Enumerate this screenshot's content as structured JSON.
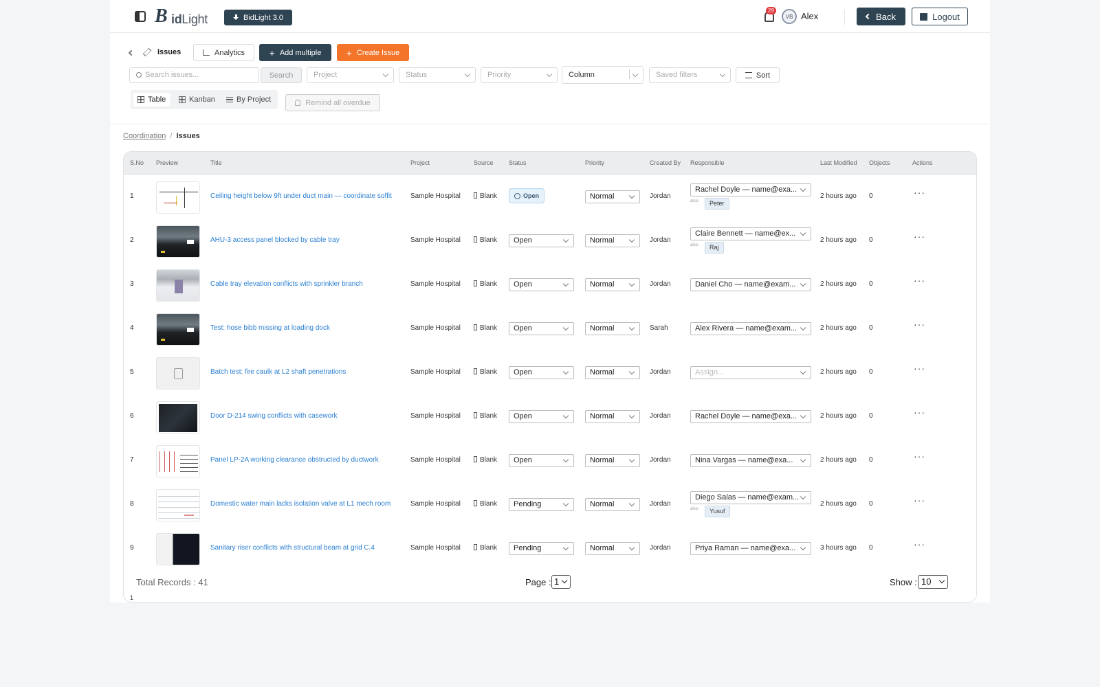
{
  "app": {
    "logo_b": "B",
    "logo_text_bold": "id",
    "logo_text_rest": "Light",
    "version_label": "BidLight 3.0",
    "notif_count": "29",
    "avatar_initials": "VB",
    "user_name": "Alex",
    "back_label": "Back",
    "logout_label": "Logout"
  },
  "toolbar": {
    "section_label": "Issues",
    "analytics_label": "Analytics",
    "add_multiple_label": "Add multiple",
    "create_issue_label": "Create Issue",
    "search_placeholder": "Search issues...",
    "search_button": "Search",
    "filters": {
      "project": "Project",
      "status": "Status",
      "priority": "Priority",
      "column": "Column",
      "saved": "Saved filters"
    },
    "sort_label": "Sort",
    "views": [
      "Table",
      "Kanban",
      "By Project"
    ],
    "active_view": "Table",
    "remind_label": "Remind all overdue"
  },
  "breadcrumb": {
    "parent": "Coordination",
    "separator": "/",
    "current": "Issues"
  },
  "table": {
    "columns": [
      "S.No",
      "Preview",
      "Title",
      "Project",
      "Source",
      "Status",
      "Priority",
      "Created By",
      "Responsible",
      "Last Modified",
      "Objects",
      "Actions"
    ],
    "also_label": "also:",
    "actions_glyph": "···",
    "rows": [
      {
        "sno": "1",
        "preview": "plan-drawing",
        "title": "Ceiling height below 9ft under duct main — coordinate soffit",
        "project": "Sample Hospital",
        "source": "Blank",
        "status": "Open",
        "status_badge": true,
        "priority": "Normal",
        "created_by": "Jordan",
        "responsible": "Rachel Doyle — name@exa...",
        "also": "Peter",
        "last_modified": "2 hours ago",
        "objects": "0"
      },
      {
        "sno": "2",
        "preview": "dark-model",
        "title": "AHU-3 access panel blocked by cable tray",
        "project": "Sample Hospital",
        "source": "Blank",
        "status": "Open",
        "priority": "Normal",
        "created_by": "Jordan",
        "responsible": "Claire Bennett — name@ex...",
        "also": "Raj",
        "last_modified": "2 hours ago",
        "objects": "0"
      },
      {
        "sno": "3",
        "preview": "tray-model",
        "title": "Cable tray elevation conflicts with sprinkler branch",
        "project": "Sample Hospital",
        "source": "Blank",
        "status": "Open",
        "priority": "Normal",
        "created_by": "Jordan",
        "responsible": "Daniel Cho — name@exam...",
        "last_modified": "2 hours ago",
        "objects": "0"
      },
      {
        "sno": "4",
        "preview": "dark-model",
        "title": "Test: hose bibb missing at loading dock",
        "project": "Sample Hospital",
        "source": "Blank",
        "status": "Open",
        "priority": "Normal",
        "created_by": "Sarah",
        "responsible": "Alex Rivera — name@exam...",
        "last_modified": "2 hours ago",
        "objects": "0"
      },
      {
        "sno": "5",
        "preview": "document-placeholder",
        "title": "Batch test: fire caulk at L2 shaft penetrations",
        "project": "Sample Hospital",
        "source": "Blank",
        "status": "Open",
        "priority": "Normal",
        "created_by": "Jordan",
        "responsible": "",
        "responsible_placeholder": "Assign...",
        "last_modified": "2 hours ago",
        "objects": "0"
      },
      {
        "sno": "6",
        "preview": "night-model",
        "title": "Door D-214 swing conflicts with casework",
        "project": "Sample Hospital",
        "source": "Blank",
        "status": "Open",
        "priority": "Normal",
        "created_by": "Jordan",
        "responsible": "Rachel Doyle — name@exa...",
        "last_modified": "2 hours ago",
        "objects": "0"
      },
      {
        "sno": "7",
        "preview": "panel-sheet",
        "title": "Panel LP-2A working clearance obstructed by ductwork",
        "project": "Sample Hospital",
        "source": "Blank",
        "status": "Open",
        "priority": "Normal",
        "created_by": "Jordan",
        "responsible": "Nina Vargas — name@exa...",
        "last_modified": "2 hours ago",
        "objects": "0"
      },
      {
        "sno": "8",
        "preview": "pale-sheet",
        "title": "Domestic water main lacks isolation valve at L1 mech room",
        "project": "Sample Hospital",
        "source": "Blank",
        "status": "Pending",
        "priority": "Normal",
        "created_by": "Jordan",
        "responsible": "Diego Salas — name@exam...",
        "also": "Yusuf",
        "last_modified": "2 hours ago",
        "objects": "0"
      },
      {
        "sno": "9",
        "preview": "split-model",
        "title": "Sanitary riser conflicts with structural beam at grid C.4",
        "project": "Sample Hospital",
        "source": "Blank",
        "status": "Pending",
        "priority": "Normal",
        "created_by": "Jordan",
        "responsible": "Priya Raman — name@exa...",
        "last_modified": "3 hours ago",
        "objects": "0"
      }
    ]
  },
  "footer": {
    "total_label": "Total Records : 41",
    "page_label": "Page :",
    "page_value": "1",
    "show_label": "Show :",
    "show_value": "10",
    "tiny_text": "1"
  },
  "colors": {
    "primary": "#2f4452",
    "accent": "#f4742a",
    "link": "#2a7fd1",
    "danger": "#e0383d"
  }
}
